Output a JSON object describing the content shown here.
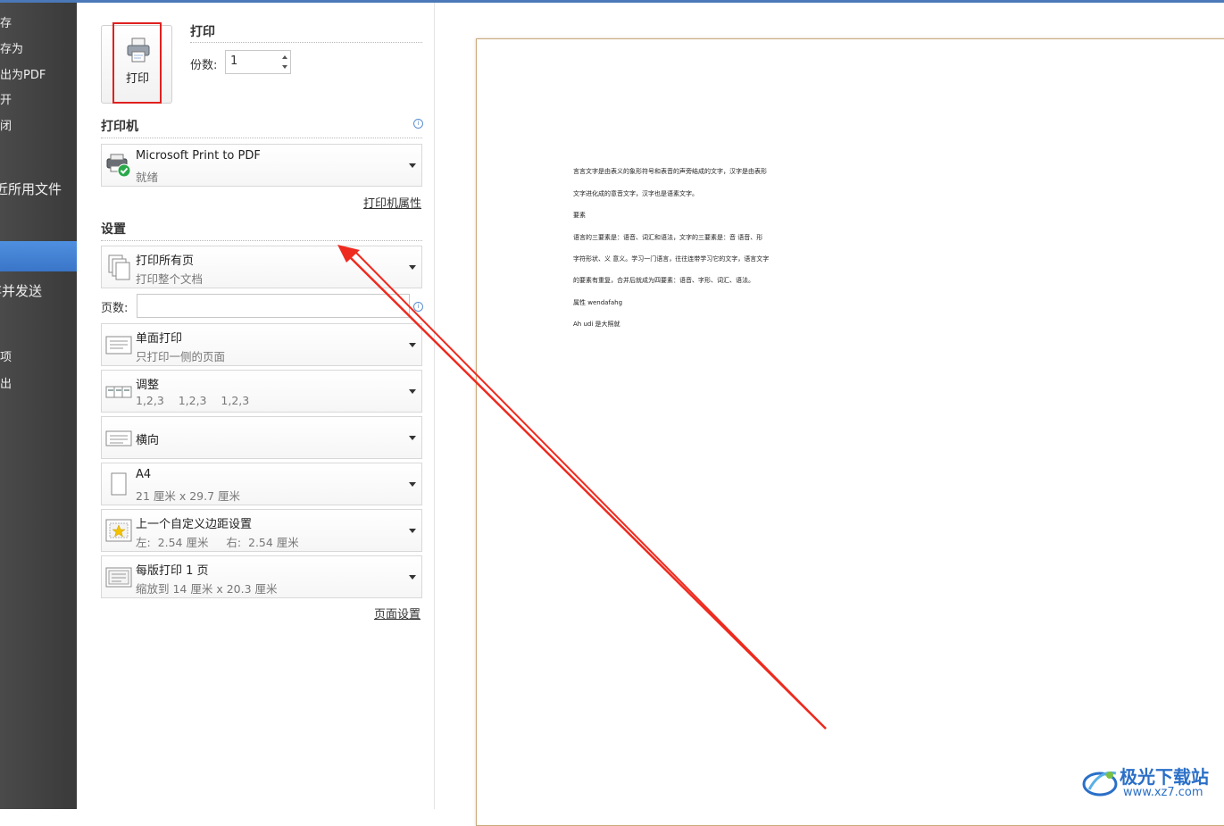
{
  "nav": {
    "items": [
      {
        "label": "存"
      },
      {
        "label": "存为"
      },
      {
        "label": "出为PDF"
      },
      {
        "label": "开"
      },
      {
        "label": "闭"
      },
      {
        "label": "近所用文件"
      },
      {
        "label": "存并发送"
      },
      {
        "label": "项"
      },
      {
        "label": "出"
      }
    ]
  },
  "print": {
    "button_label": "打印",
    "section_title": "打印",
    "copies_label": "份数:",
    "copies_value": "1"
  },
  "printer": {
    "section_title": "打印机",
    "name": "Microsoft Print to PDF",
    "status": "就绪",
    "properties_link": "打印机属性"
  },
  "settings": {
    "section_title": "设置",
    "pages_label": "页数:",
    "pages_placeholder": "",
    "options": [
      {
        "main": "打印所有页",
        "sub": "打印整个文档",
        "icon": "pages-icon"
      },
      {
        "main": "单面打印",
        "sub": "只打印一侧的页面",
        "icon": "single-side-icon"
      },
      {
        "main": "调整",
        "sub": "1,2,3    1,2,3    1,2,3",
        "icon": "collate-icon"
      },
      {
        "main": "横向",
        "sub": "",
        "icon": "landscape-icon"
      },
      {
        "main": "A4",
        "sub": "21 厘米 x 29.7 厘米",
        "icon": "paper-size-icon"
      },
      {
        "main": "上一个自定义边距设置",
        "sub": "左:  2.54 厘米     右:  2.54 厘米",
        "icon": "margins-icon"
      },
      {
        "main": "每版打印 1 页",
        "sub": "缩放到 14 厘米 x 20.3 厘米",
        "icon": "pages-per-sheet-icon"
      }
    ],
    "page_setup_link": "页面设置"
  },
  "preview": {
    "lines": [
      "言言文字是由表义的象形符号和表音的声旁结成的文字，汉字是由表形",
      "文字进化成的意音文字，汉字也是语素文字。",
      "要素",
      "语言的三要素是：语音、词汇和语法，文字的三要素是：音 语音、形",
      "字符形状、义 意义。学习一门语言，往往连带学习它的文字，语言文字",
      "的要素有重复，合并后就成为四要素：语音、字形、词汇、语法。",
      "属性 wendafahg",
      "Ah udi 是大照就"
    ]
  },
  "watermark": {
    "text": "极光下载站",
    "url": "www.xz7.com"
  },
  "colors": {
    "accent": "#3a75c8",
    "highlight": "#e02020",
    "arrow": "#ee2a1f",
    "nav_bg": "#434343"
  }
}
